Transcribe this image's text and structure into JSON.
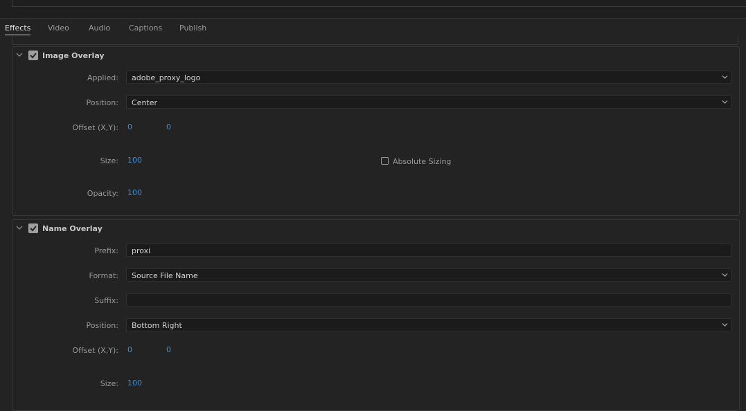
{
  "tabs": [
    {
      "label": "Effects",
      "active": true
    },
    {
      "label": "Video",
      "active": false
    },
    {
      "label": "Audio",
      "active": false
    },
    {
      "label": "Captions",
      "active": false
    },
    {
      "label": "Publish",
      "active": false
    }
  ],
  "image_overlay": {
    "title": "Image Overlay",
    "enabled": true,
    "applied_label": "Applied:",
    "applied_value": "adobe_proxy_logo",
    "position_label": "Position:",
    "position_value": "Center",
    "offset_label": "Offset (X,Y):",
    "offset_x": "0",
    "offset_y": "0",
    "size_label": "Size:",
    "size_value": "100",
    "absolute_sizing_label": "Absolute Sizing",
    "absolute_sizing_checked": false,
    "opacity_label": "Opacity:",
    "opacity_value": "100"
  },
  "name_overlay": {
    "title": "Name Overlay",
    "enabled": true,
    "prefix_label": "Prefix:",
    "prefix_value": "proxi",
    "format_label": "Format:",
    "format_value": "Source File Name",
    "suffix_label": "Suffix:",
    "suffix_value": "",
    "position_label": "Position:",
    "position_value": "Bottom Right",
    "offset_label": "Offset (X,Y):",
    "offset_x": "0",
    "offset_y": "0",
    "size_label": "Size:",
    "size_value": "100"
  },
  "colors": {
    "background": "#232323",
    "accent_number": "#3d8fd6",
    "field_background": "#1b1b1b"
  }
}
